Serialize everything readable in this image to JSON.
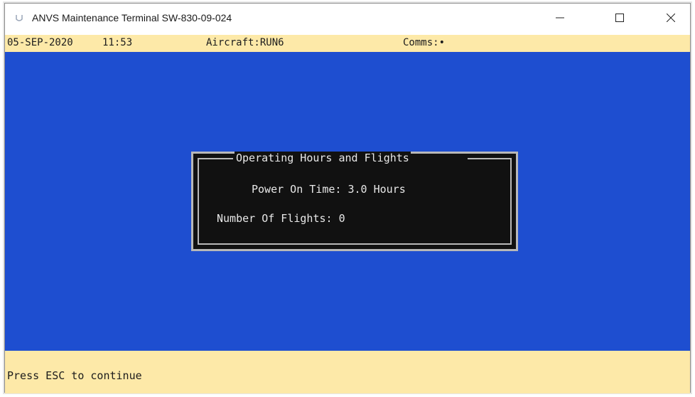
{
  "window": {
    "title": "ANVS Maintenance Terminal SW-830-09-024",
    "icon": "app-icon",
    "controls": [
      "minimize-icon",
      "maximize-icon",
      "close-icon"
    ]
  },
  "status": {
    "date": "05-SEP-2020",
    "time": "11:53",
    "aircraft": "Aircraft:RUN6",
    "comms": "Comms:•"
  },
  "dialog": {
    "title": "Operating Hours and Flights",
    "power_on": "Power On Time: 3.0 Hours",
    "flights": "Number Of Flights: 0"
  },
  "prompt": {
    "text": "Press ESC to continue"
  },
  "colors": {
    "console_bg": "#1e4ed0",
    "status_bg": "#fde9a8",
    "dialog_bg": "#111111",
    "dialog_border": "#b8b8b8"
  }
}
